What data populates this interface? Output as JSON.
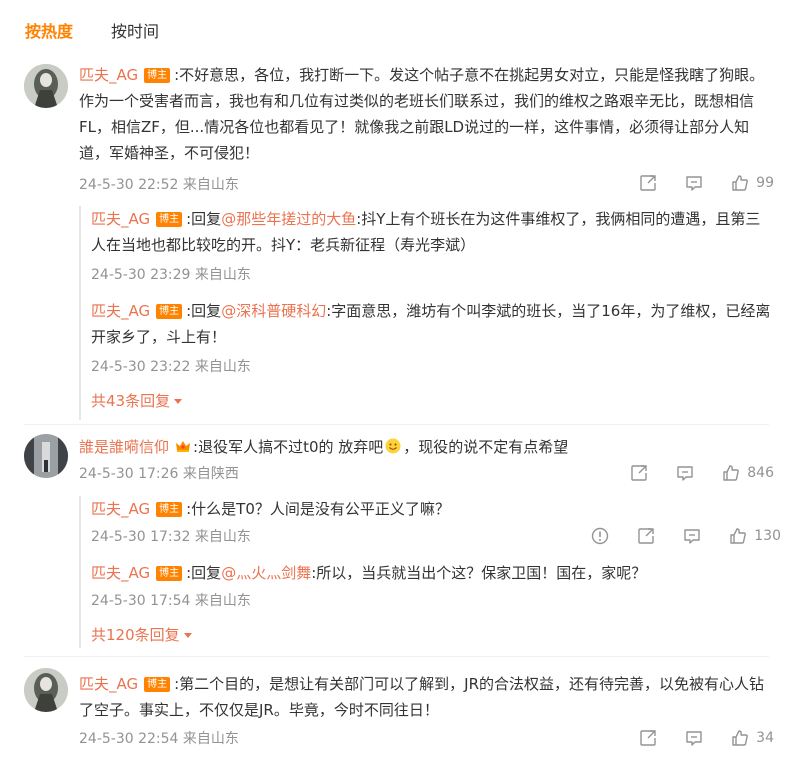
{
  "tabs": {
    "hot": "按热度",
    "time": "按时间"
  },
  "badge": "博主",
  "comments": [
    {
      "name": "匹夫_AG",
      "text": ":不好意思，各位，我打断一下。发这个帖子意不在挑起男女对立，只能是怪我瞎了狗眼。作为一个受害者而言，我也有和几位有过类似的老班长们联系过，我们的维权之路艰辛无比，既想相信FL，相信ZF，但...情况各位也都看见了！就像我之前跟LD说过的一样，这件事情，必须得让部分人知道，军婚神圣，不可侵犯！",
      "meta": "24-5-30 22:52 来自山东",
      "likes": "99",
      "replies": [
        {
          "name": "匹夫_AG",
          "prefix": ":回复",
          "mention": "@那些年搓过的大鱼",
          "text": ":抖Y上有个班长在为这件事维权了，我俩相同的遭遇，且第三人在当地也都比较吃的开。抖Y：老兵新征程（寿光李斌）",
          "meta": "24-5-30 23:29 来自山东"
        },
        {
          "name": "匹夫_AG",
          "prefix": ":回复",
          "mention": "@深科普硬科幻",
          "text": ":字面意思，潍坊有个叫李斌的班长，当了16年，为了维权，已经离开家乡了，斗上有！",
          "meta": "24-5-30 23:22 来自山东"
        }
      ],
      "more": "共43条回复"
    },
    {
      "name": "誰是誰嗬信仰",
      "text_a": ":退役军人搞不过t0的 放弃吧",
      "text_b": "，现役的说不定有点希望",
      "meta": "24-5-30 17:26 来自陕西",
      "likes": "846",
      "replies": [
        {
          "name": "匹夫_AG",
          "text": ":什么是T0？人间是没有公平正义了嘛？",
          "meta": "24-5-30 17:32 来自山东",
          "likes": "130"
        },
        {
          "name": "匹夫_AG",
          "prefix": ":回复",
          "mention": "@灬火灬剑舞",
          "text": ":所以，当兵就当出个这？保家卫国！国在，家呢？",
          "meta": "24-5-30 17:54 来自山东"
        }
      ],
      "more": "共120条回复"
    },
    {
      "name": "匹夫_AG",
      "text": ":第二个目的，是想让有关部门可以了解到，JR的合法权益，还有待完善，以免被有心人钻了空子。事实上，不仅仅是JR。毕竟，今时不同往日！",
      "meta": "24-5-30 22:54 来自山东",
      "likes": "34"
    }
  ],
  "icons": [
    "share-icon",
    "comment-icon",
    "like-icon",
    "report-icon",
    "crown-icon",
    "smile-emoji-icon",
    "caret-down-icon"
  ],
  "colors": {
    "accent": "#ff8200",
    "username": "#eb7350",
    "meta": "#939393",
    "text": "#333333"
  }
}
